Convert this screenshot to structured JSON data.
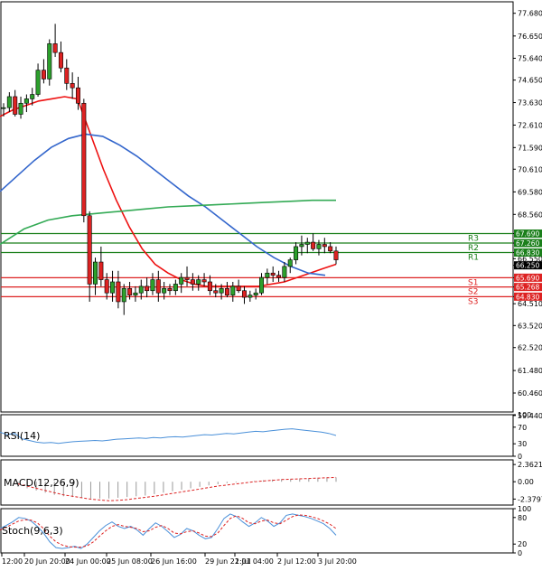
{
  "chart_data": [
    {
      "type": "candlestick",
      "panel": "price",
      "ylim": [
        59.6,
        78.2
      ],
      "price_ticks": [
        "77.680",
        "76.650",
        "75.640",
        "74.650",
        "73.630",
        "72.610",
        "71.590",
        "70.610",
        "69.580",
        "68.560",
        "67.690",
        "67.260",
        "66.830",
        "66.550",
        "66.250",
        "65.690",
        "65.268",
        "64.830",
        "64.510",
        "63.520",
        "62.520",
        "61.480",
        "60.460",
        "59.440"
      ],
      "time_labels": [
        "12:00",
        "20 Jun 20:00",
        "24 Jun 00:00",
        "25 Jun 08:00",
        "26 Jun 16:00",
        "29 Jun 22:01",
        "1 Jul 04:00",
        "2 Jul 12:00",
        "3 Jul 20:00"
      ],
      "candles": [
        [
          73.4,
          73.6,
          73.0,
          73.4
        ],
        [
          73.4,
          74.1,
          73.2,
          73.9
        ],
        [
          73.9,
          74.2,
          73.0,
          73.1
        ],
        [
          73.1,
          73.9,
          72.9,
          73.6
        ],
        [
          73.6,
          74.0,
          73.2,
          73.8
        ],
        [
          73.8,
          74.3,
          73.5,
          74.0
        ],
        [
          74.0,
          75.4,
          73.9,
          75.1
        ],
        [
          75.1,
          75.6,
          74.5,
          74.7
        ],
        [
          74.7,
          76.5,
          74.4,
          76.3
        ],
        [
          76.3,
          77.2,
          75.7,
          75.9
        ],
        [
          75.9,
          76.4,
          75.0,
          75.2
        ],
        [
          75.2,
          75.6,
          74.2,
          74.5
        ],
        [
          74.5,
          75.0,
          73.8,
          74.3
        ],
        [
          74.3,
          74.8,
          73.3,
          73.6
        ],
        [
          73.6,
          73.8,
          68.2,
          68.5
        ],
        [
          68.5,
          68.7,
          64.6,
          65.4
        ],
        [
          65.4,
          66.6,
          64.9,
          66.4
        ],
        [
          66.4,
          67.1,
          65.3,
          65.6
        ],
        [
          65.6,
          65.9,
          64.7,
          65.0
        ],
        [
          65.0,
          66.0,
          64.6,
          65.5
        ],
        [
          65.5,
          66.0,
          64.3,
          64.6
        ],
        [
          64.6,
          65.4,
          64.0,
          65.2
        ],
        [
          65.2,
          65.5,
          64.7,
          64.9
        ],
        [
          64.9,
          65.3,
          64.6,
          65.0
        ],
        [
          65.0,
          65.6,
          64.7,
          65.3
        ],
        [
          65.3,
          65.7,
          64.8,
          65.1
        ],
        [
          65.1,
          65.9,
          64.9,
          65.6
        ],
        [
          65.6,
          66.0,
          64.6,
          65.0
        ],
        [
          65.0,
          65.5,
          64.7,
          65.2
        ],
        [
          65.2,
          65.4,
          64.9,
          65.1
        ],
        [
          65.1,
          65.6,
          64.9,
          65.4
        ],
        [
          65.4,
          65.9,
          65.0,
          65.7
        ],
        [
          65.7,
          66.2,
          65.3,
          65.6
        ],
        [
          65.6,
          65.9,
          65.1,
          65.4
        ],
        [
          65.4,
          65.8,
          65.1,
          65.6
        ],
        [
          65.6,
          65.9,
          65.3,
          65.5
        ],
        [
          65.5,
          65.8,
          64.9,
          65.1
        ],
        [
          65.1,
          65.4,
          64.8,
          65.0
        ],
        [
          65.0,
          65.4,
          64.7,
          65.2
        ],
        [
          65.2,
          65.5,
          64.8,
          64.9
        ],
        [
          64.9,
          65.5,
          64.6,
          65.3
        ],
        [
          65.3,
          65.6,
          65.0,
          65.1
        ],
        [
          65.1,
          65.3,
          64.5,
          64.8
        ],
        [
          64.8,
          65.1,
          64.6,
          64.9
        ],
        [
          64.9,
          65.2,
          64.7,
          65.0
        ],
        [
          65.0,
          65.9,
          64.9,
          65.7
        ],
        [
          65.7,
          66.1,
          65.4,
          65.9
        ],
        [
          65.9,
          66.2,
          65.5,
          65.8
        ],
        [
          65.8,
          66.0,
          65.5,
          65.7
        ],
        [
          65.7,
          66.4,
          65.5,
          66.2
        ],
        [
          66.2,
          66.6,
          65.9,
          66.5
        ],
        [
          66.5,
          67.3,
          66.3,
          67.1
        ],
        [
          67.1,
          67.6,
          66.7,
          67.2
        ],
        [
          67.2,
          67.5,
          66.8,
          67.3
        ],
        [
          67.3,
          67.7,
          66.9,
          67.0
        ],
        [
          67.0,
          67.4,
          66.7,
          67.2
        ],
        [
          67.2,
          67.5,
          66.8,
          67.1
        ],
        [
          67.1,
          67.3,
          66.8,
          66.9
        ],
        [
          66.9,
          67.1,
          66.3,
          66.5
        ]
      ],
      "series": [
        {
          "name": "MA red",
          "color": "#ee1111",
          "values": [
            73.0,
            73.3,
            73.5,
            73.7,
            73.8,
            73.9,
            73.8,
            72.2,
            70.6,
            69.2,
            68.0,
            67.0,
            66.3,
            65.9,
            65.6,
            65.4,
            65.3,
            65.3,
            65.3,
            65.3,
            65.3,
            65.4,
            65.5,
            65.7,
            65.9,
            66.1,
            66.3
          ]
        },
        {
          "name": "MA blue",
          "color": "#3366cc",
          "values": [
            69.6,
            70.3,
            71.0,
            71.6,
            72.0,
            72.2,
            72.1,
            71.7,
            71.2,
            70.6,
            70.0,
            69.4,
            68.9,
            68.3,
            67.7,
            67.1,
            66.6,
            66.2,
            65.9,
            65.8
          ]
        },
        {
          "name": "MA green",
          "color": "#33aa55",
          "values": [
            67.2,
            67.9,
            68.3,
            68.5,
            68.6,
            68.7,
            68.8,
            68.9,
            68.95,
            69.0,
            69.05,
            69.1,
            69.15,
            69.2,
            69.2
          ]
        }
      ],
      "levels": [
        {
          "label": "R3",
          "value": 67.69,
          "tag": "67.690",
          "color": "#1a7f1a"
        },
        {
          "label": "R2",
          "value": 67.26,
          "tag": "67.260",
          "color": "#1a7f1a"
        },
        {
          "label": "R1",
          "value": 66.83,
          "tag": "66.830",
          "color": "#1a7f1a"
        },
        {
          "label": "S1",
          "value": 65.69,
          "tag": "65.690",
          "color": "#dd2222"
        },
        {
          "label": "S2",
          "value": 65.268,
          "tag": "65.268",
          "color": "#dd2222"
        },
        {
          "label": "S3",
          "value": 64.83,
          "tag": "64.830",
          "color": "#dd2222"
        }
      ],
      "current_price": "66.250",
      "current_price_value": 66.25
    },
    {
      "type": "line",
      "panel": "RSI",
      "label": "RSI(14)",
      "ylim": [
        0,
        100
      ],
      "ticks": [
        "100",
        "70",
        "30",
        "0"
      ],
      "color": "#4a90d9",
      "values": [
        58,
        52,
        55,
        42,
        38,
        34,
        32,
        33,
        31,
        33,
        35,
        36,
        37,
        38,
        37,
        39,
        41,
        42,
        43,
        44,
        43,
        45,
        44,
        46,
        47,
        46,
        48,
        50,
        52,
        51,
        53,
        55,
        54,
        56,
        58,
        60,
        59,
        61,
        63,
        65,
        66,
        64,
        62,
        60,
        58,
        55,
        50
      ]
    },
    {
      "type": "bar",
      "panel": "MACD",
      "label": "MACD(12,26,9)",
      "ylim": [
        -3.2,
        3.0
      ],
      "ticks": [
        "2.3621",
        "0.00",
        "-2.3797"
      ],
      "values": [
        -0.7,
        -0.9,
        -1.2,
        -1.5,
        -1.8,
        -2.0,
        -2.1,
        -2.2,
        -2.3,
        -2.3,
        -2.3,
        -2.2,
        -2.1,
        -2.0,
        -1.9,
        -1.7,
        -1.5,
        -1.3,
        -1.1,
        -0.9,
        -0.7,
        -0.5,
        -0.35,
        -0.2,
        -0.1,
        0.0,
        0.1,
        0.2,
        0.3,
        0.35,
        0.4,
        0.45,
        0.5,
        0.55,
        0.6,
        0.6
      ],
      "signal": [
        -0.3,
        -0.6,
        -0.9,
        -1.2,
        -1.5,
        -1.8,
        -2.0,
        -2.2,
        -2.4,
        -2.5,
        -2.6,
        -2.55,
        -2.45,
        -2.3,
        -2.15,
        -2.0,
        -1.8,
        -1.6,
        -1.4,
        -1.2,
        -1.0,
        -0.8,
        -0.6,
        -0.45,
        -0.3,
        -0.15,
        0.0,
        0.1,
        0.2,
        0.3,
        0.35,
        0.4,
        0.45,
        0.5,
        0.55,
        0.6
      ]
    },
    {
      "type": "line",
      "panel": "Stoch",
      "label": "Stoch(9,6,3)",
      "ylim": [
        0,
        100
      ],
      "ticks": [
        "100",
        "80",
        "20",
        "0"
      ],
      "main": [
        55,
        62,
        70,
        80,
        78,
        72,
        60,
        45,
        25,
        12,
        10,
        12,
        15,
        10,
        20,
        35,
        50,
        62,
        70,
        60,
        55,
        60,
        52,
        40,
        55,
        68,
        60,
        48,
        35,
        42,
        55,
        50,
        40,
        32,
        35,
        55,
        78,
        88,
        82,
        70,
        60,
        68,
        80,
        72,
        60,
        68,
        85,
        88,
        85,
        82,
        78,
        72,
        66,
        55,
        40
      ],
      "signal": [
        52,
        58,
        65,
        72,
        75,
        74,
        68,
        55,
        38,
        25,
        18,
        14,
        13,
        13,
        16,
        25,
        38,
        50,
        60,
        64,
        60,
        58,
        55,
        48,
        50,
        58,
        62,
        55,
        45,
        43,
        48,
        50,
        45,
        38,
        37,
        45,
        62,
        78,
        84,
        78,
        68,
        66,
        72,
        74,
        68,
        66,
        74,
        82,
        86,
        85,
        82,
        78,
        72,
        65,
        55
      ]
    }
  ]
}
